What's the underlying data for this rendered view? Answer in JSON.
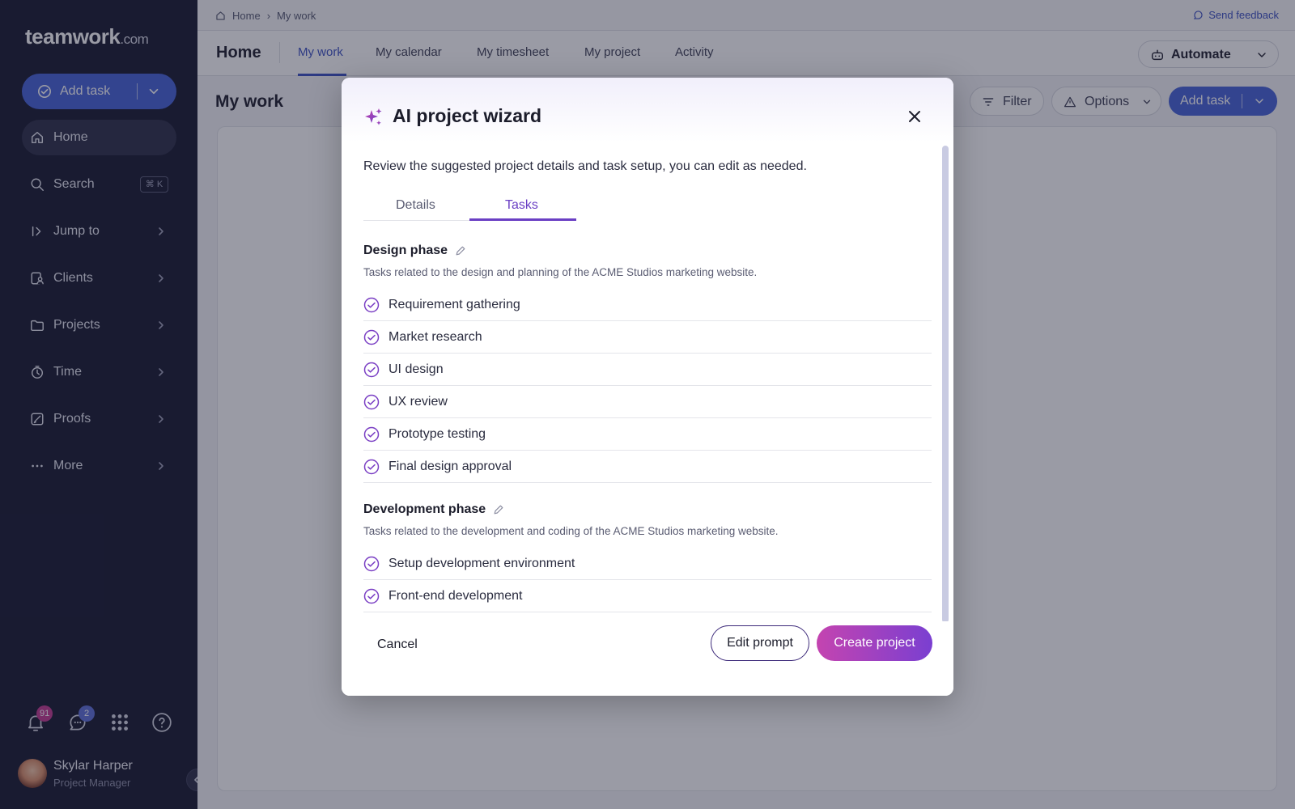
{
  "sidebar": {
    "logo": {
      "brand": "teamwork",
      "suffix": ".com"
    },
    "add_task_label": "Add task",
    "items": [
      {
        "id": "home",
        "label": "Home",
        "icon": "home-icon",
        "active": true
      },
      {
        "id": "search",
        "label": "Search",
        "icon": "search-icon",
        "shortcut": "⌘ K"
      },
      {
        "id": "jump-to",
        "label": "Jump to",
        "icon": "jump-icon"
      },
      {
        "id": "clients",
        "label": "Clients",
        "icon": "clients-icon"
      },
      {
        "id": "projects",
        "label": "Projects",
        "icon": "folder-icon"
      },
      {
        "id": "time",
        "label": "Time",
        "icon": "timer-icon"
      },
      {
        "id": "proofs",
        "label": "Proofs",
        "icon": "proofs-icon"
      },
      {
        "id": "more",
        "label": "More",
        "icon": "ellipsis-icon"
      }
    ],
    "notifications_count": "91",
    "chat_count": "2",
    "user": {
      "name": "Skylar Harper",
      "role": "Project Manager"
    }
  },
  "topbar": {
    "breadcrumb": [
      "Home",
      "My work"
    ],
    "feedback": "Send feedback"
  },
  "header": {
    "title": "Home",
    "tabs": [
      "My work",
      "My calendar",
      "My timesheet",
      "My project",
      "Activity"
    ],
    "active_tab": "My work",
    "automate": "Automate"
  },
  "page": {
    "title": "My work",
    "filter": "Filter",
    "options": "Options",
    "add_task": "Add task"
  },
  "modal": {
    "title": "AI project wizard",
    "description": "Review the suggested project details and task setup, you can edit as needed.",
    "tabs": [
      "Details",
      "Tasks"
    ],
    "active_tab": "Tasks",
    "phases": [
      {
        "title": "Design phase",
        "description": "Tasks related to the design and planning of the ACME Studios marketing website.",
        "tasks": [
          "Requirement gathering",
          "Market research",
          "UI design",
          "UX review",
          "Prototype testing",
          "Final design approval"
        ]
      },
      {
        "title": "Development phase",
        "description": "Tasks related to the development and coding of the ACME Studios marketing website.",
        "tasks": [
          "Setup development environment",
          "Front-end development"
        ]
      }
    ],
    "cancel": "Cancel",
    "edit_prompt": "Edit prompt",
    "create_project": "Create project"
  },
  "colors": {
    "sidebar_bg": "#14162d",
    "brand_blue": "#4461d7",
    "accent_purple": "#6a3fc4",
    "create_gradient_start": "#c444b0",
    "create_gradient_end": "#7a3fd1",
    "notification_badge": "#c2378f",
    "chat_badge": "#5b6ed8"
  }
}
